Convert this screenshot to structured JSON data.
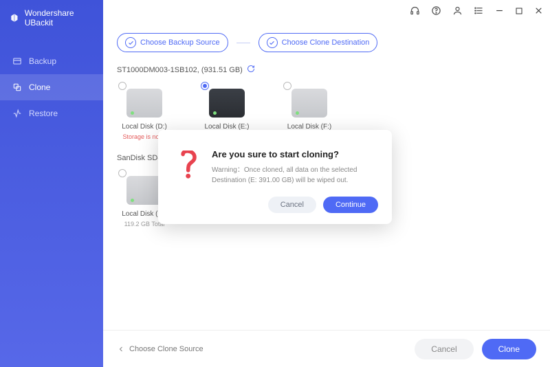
{
  "brand": {
    "name": "Wondershare UBackit"
  },
  "sidebar": {
    "items": [
      {
        "label": "Backup"
      },
      {
        "label": "Clone"
      },
      {
        "label": "Restore"
      }
    ]
  },
  "steps": {
    "step1": "Choose Backup Source",
    "step2": "Choose Clone Destination"
  },
  "source1": {
    "label": "ST1000DM003-1SB102, (931.51 GB)",
    "disks": [
      {
        "name": "Local Disk (D:)",
        "error": "Storage is not e"
      },
      {
        "name": "Local Disk (E:)"
      },
      {
        "name": "Local Disk (F:)"
      }
    ]
  },
  "source2": {
    "label": "SanDisk SD8SB",
    "disks": [
      {
        "name": "Local Disk (C:)",
        "sub": "119.2 GB Total"
      }
    ]
  },
  "footer": {
    "back": "Choose Clone Source",
    "cancel": "Cancel",
    "clone": "Clone"
  },
  "modal": {
    "title": "Are you sure to start cloning?",
    "text": "Warning：Once cloned, all data on the selected Destination (E: 391.00 GB) will be wiped out.",
    "cancel": "Cancel",
    "continue": "Continue"
  }
}
